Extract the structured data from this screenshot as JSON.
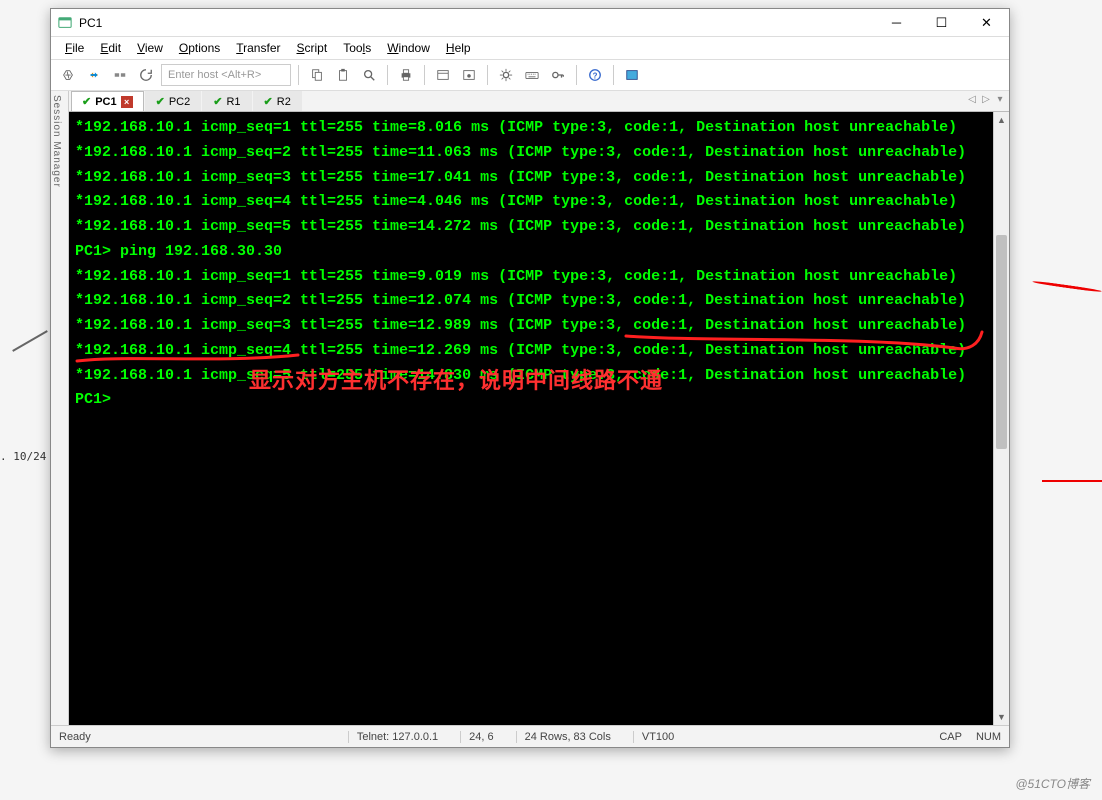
{
  "bg": {
    "ip_label": ". 10/24"
  },
  "watermark": "@51CTO博客",
  "window": {
    "title": "PC1",
    "menus": [
      "File",
      "Edit",
      "View",
      "Options",
      "Transfer",
      "Script",
      "Tools",
      "Window",
      "Help"
    ],
    "host_placeholder": "Enter host <Alt+R>"
  },
  "side_label": "Session Manager",
  "tabs": [
    {
      "name": "PC1",
      "active": true,
      "closebox": true
    },
    {
      "name": "PC2",
      "active": false,
      "closebox": false
    },
    {
      "name": "R1",
      "active": false,
      "closebox": false
    },
    {
      "name": "R2",
      "active": false,
      "closebox": false
    }
  ],
  "terminal_lines": [
    "*192.168.10.1 icmp_seq=1 ttl=255 time=8.016 ms (ICMP type:3, code:1, Destination host unreachable)",
    "*192.168.10.1 icmp_seq=2 ttl=255 time=11.063 ms (ICMP type:3, code:1, Destination host unreachable)",
    "*192.168.10.1 icmp_seq=3 ttl=255 time=17.041 ms (ICMP type:3, code:1, Destination host unreachable)",
    "*192.168.10.1 icmp_seq=4 ttl=255 time=4.046 ms (ICMP type:3, code:1, Destination host unreachable)",
    "*192.168.10.1 icmp_seq=5 ttl=255 time=14.272 ms (ICMP type:3, code:1, Destination host unreachable)",
    "PC1> ping 192.168.30.30",
    "*192.168.10.1 icmp_seq=1 ttl=255 time=9.019 ms (ICMP type:3, code:1, Destination host unreachable)",
    "*192.168.10.1 icmp_seq=2 ttl=255 time=12.074 ms (ICMP type:3, code:1, Destination host unreachable)",
    "*192.168.10.1 icmp_seq=3 ttl=255 time=12.989 ms (ICMP type:3, code:1, Destination host unreachable)",
    "*192.168.10.1 icmp_seq=4 ttl=255 time=12.269 ms (ICMP type:3, code:1, Destination host unreachable)",
    "*192.168.10.1 icmp_seq=5 ttl=255 time=14.830 ms (ICMP type:3, code:1, Destination host unreachable)",
    "",
    "PC1>"
  ],
  "annotation_text": "显示对方主机不存在，说明中间线路不通",
  "status": {
    "left": "Ready",
    "conn": "Telnet: 127.0.0.1",
    "pos": "24,  6",
    "size": "24 Rows, 83 Cols",
    "emu": "VT100",
    "cap": "CAP",
    "num": "NUM"
  }
}
